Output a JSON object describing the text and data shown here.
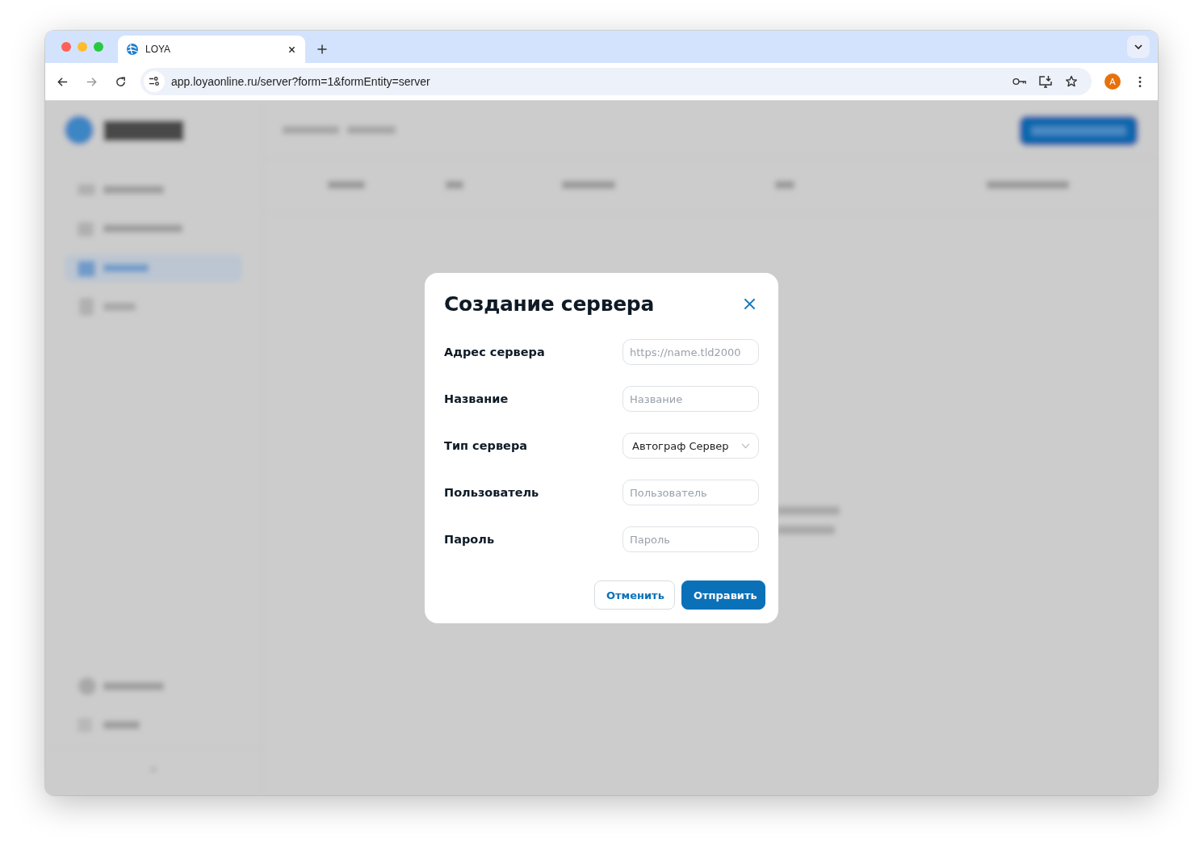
{
  "browser": {
    "tab": {
      "title": "LOYA"
    },
    "address_bar": {
      "url": "app.loyaonline.ru/server?form=1&formEntity=server"
    },
    "profile": {
      "initial": "A"
    }
  },
  "dialog": {
    "title": "Создание сервера",
    "fields": [
      {
        "label": "Адрес сервера",
        "kind": "text",
        "placeholder": "https://name.tld2000"
      },
      {
        "label": "Название",
        "kind": "text",
        "placeholder": "Название"
      },
      {
        "label": "Тип сервера",
        "kind": "select",
        "value": "Автограф Сервер"
      },
      {
        "label": "Пользователь",
        "kind": "text",
        "placeholder": "Пользователь"
      },
      {
        "label": "Пароль",
        "kind": "password",
        "placeholder": "Пароль"
      }
    ],
    "buttons": [
      {
        "label": "Отменить",
        "kind": "secondary"
      },
      {
        "label": "Отправить",
        "kind": "primary"
      }
    ]
  }
}
